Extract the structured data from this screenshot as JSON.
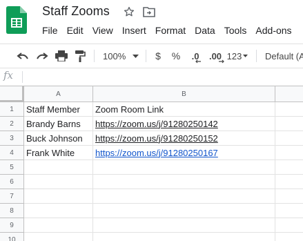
{
  "app": {
    "doc_title": "Staff Zooms",
    "brand_color": "#0f9d58",
    "icons": [
      "sheets-logo-icon",
      "star-icon",
      "move-to-folder-icon"
    ]
  },
  "menu": [
    "File",
    "Edit",
    "View",
    "Insert",
    "Format",
    "Data",
    "Tools",
    "Add-ons"
  ],
  "toolbar": {
    "zoom": "100%",
    "currency": "$",
    "percent": "%",
    "decrease_decimal": ".0",
    "increase_decimal": ".00",
    "more_formats": "123",
    "font": "Default (A",
    "icons": [
      "undo-icon",
      "redo-icon",
      "print-icon",
      "paint-format-icon",
      "chevron-down-icon"
    ]
  },
  "formula_bar": {
    "fx": "fx",
    "value": ""
  },
  "sheet": {
    "columns": [
      "A",
      "B"
    ],
    "rows": [
      "1",
      "2",
      "3",
      "4",
      "5",
      "6",
      "7",
      "8",
      "9",
      "10"
    ],
    "cells": [
      [
        "Staff Member",
        "Zoom Room Link"
      ],
      [
        "Brandy Barns",
        "https://zoom.us/j/91280250142"
      ],
      [
        "Buck Johnson",
        "https://zoom.us/j/91280250152"
      ],
      [
        "Frank White",
        "https://zoom.us/j/91280250167"
      ]
    ],
    "link_color_default": "#202124",
    "link_color_blue": "#1155cc"
  }
}
